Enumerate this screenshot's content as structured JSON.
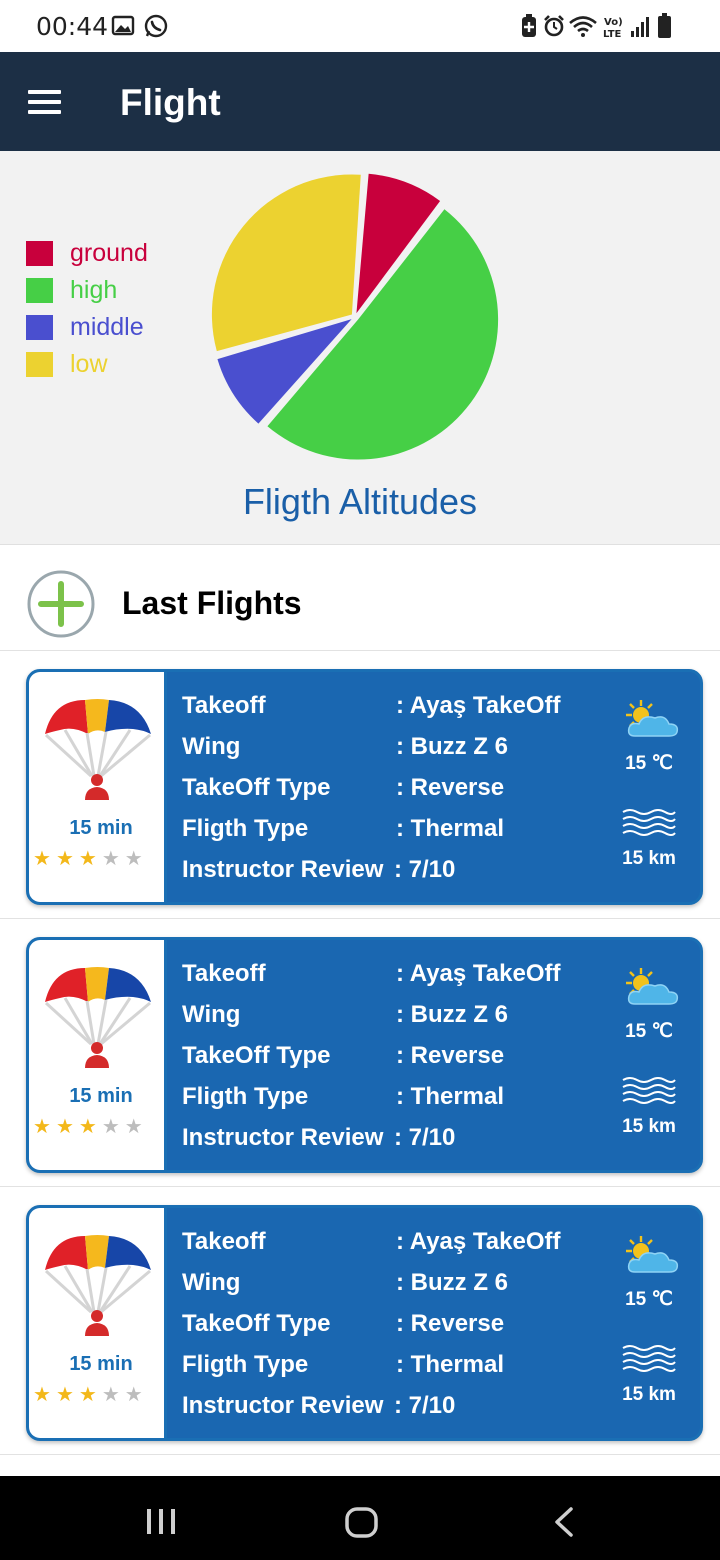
{
  "status_bar": {
    "time": "00:44",
    "left_icons": [
      "gallery-icon",
      "whatsapp-icon"
    ],
    "right_icons": [
      "battery-saver-icon",
      "alarm-icon",
      "wifi-icon",
      "volte-icon",
      "signal-icon",
      "battery-icon"
    ],
    "volte_label": "Vo)\nLTE"
  },
  "app_bar": {
    "title": "Flight",
    "menu_icon": "hamburger-menu-icon"
  },
  "chart_data": {
    "type": "pie",
    "title": "Fligth Altitudes",
    "legend_position": "left",
    "slices": [
      {
        "label": "ground",
        "value": 9,
        "color": "#c8003c"
      },
      {
        "label": "high",
        "value": 50,
        "color": "#46cf46"
      },
      {
        "label": "middle",
        "value": 9,
        "color": "#4a4fcf"
      },
      {
        "label": "low",
        "value": 30,
        "color": "#ecd230"
      }
    ]
  },
  "last_flights": {
    "title": "Last Flights",
    "add_icon": "plus-circle-icon",
    "cards": [
      {
        "duration": "15 min",
        "rating": 3,
        "rating_max": 5,
        "fields": [
          {
            "key": "Takeoff",
            "value": ": Ayaş TakeOff"
          },
          {
            "key": "Wing",
            "value": ": Buzz Z 6"
          },
          {
            "key": "TakeOff Type",
            "value": ": Reverse"
          },
          {
            "key": "Fligth Type",
            "value": ": Thermal"
          },
          {
            "key": "Instructor Review",
            "value": ": 7/10"
          }
        ],
        "temperature": "15 ℃",
        "wind": "15 km"
      },
      {
        "duration": "15 min",
        "rating": 3,
        "rating_max": 5,
        "fields": [
          {
            "key": "Takeoff",
            "value": ": Ayaş TakeOff"
          },
          {
            "key": "Wing",
            "value": ": Buzz Z 6"
          },
          {
            "key": "TakeOff Type",
            "value": ": Reverse"
          },
          {
            "key": "Fligth Type",
            "value": ": Thermal"
          },
          {
            "key": "Instructor Review",
            "value": ": 7/10"
          }
        ],
        "temperature": "15 ℃",
        "wind": "15 km"
      },
      {
        "duration": "15 min",
        "rating": 3,
        "rating_max": 5,
        "fields": [
          {
            "key": "Takeoff",
            "value": ": Ayaş TakeOff"
          },
          {
            "key": "Wing",
            "value": ": Buzz Z 6"
          },
          {
            "key": "TakeOff Type",
            "value": ": Reverse"
          },
          {
            "key": "Fligth Type",
            "value": ": Thermal"
          },
          {
            "key": "Instructor Review",
            "value": ": 7/10"
          }
        ],
        "temperature": "15 ℃",
        "wind": "15 km"
      }
    ]
  },
  "nav_bar": {
    "buttons": [
      "recent-apps-icon",
      "home-icon",
      "back-icon"
    ]
  }
}
